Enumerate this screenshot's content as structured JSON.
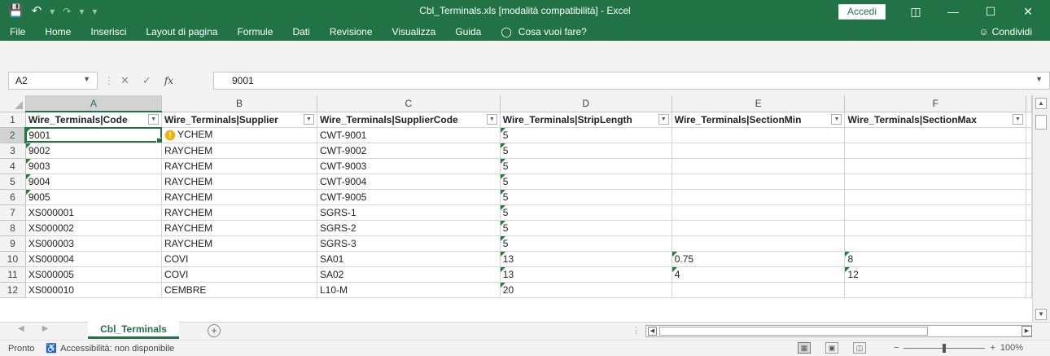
{
  "window": {
    "title": "Cbl_Terminals.xls  [modalità compatibilità]  -  Excel",
    "signin_label": "Accedi",
    "qat": {
      "save_icon": "save-icon",
      "undo_icon": "undo-icon",
      "redo_icon": "redo-icon"
    }
  },
  "ribbon": {
    "tabs": [
      "File",
      "Home",
      "Inserisci",
      "Layout di pagina",
      "Formule",
      "Dati",
      "Revisione",
      "Visualizza",
      "Guida"
    ],
    "tellme_label": "Cosa vuoi fare?",
    "share_label": "Condividi"
  },
  "formula_bar": {
    "name_box": "A2",
    "fx_label": "fx",
    "value": "9001"
  },
  "grid": {
    "columns": [
      "A",
      "B",
      "C",
      "D",
      "E",
      "F"
    ],
    "selected_column": "A",
    "selected_row": 2,
    "header_row": [
      "Wire_Terminals|Code",
      "Wire_Terminals|Supplier",
      "Wire_Terminals|SupplierCode",
      "Wire_Terminals|StripLength",
      "Wire_Terminals|SectionMin",
      "Wire_Terminals|SectionMax"
    ],
    "rows": [
      {
        "n": "2",
        "cells": [
          "9001",
          "YCHEM",
          "CWT-9001",
          "5",
          "",
          ""
        ]
      },
      {
        "n": "3",
        "cells": [
          "9002",
          "RAYCHEM",
          "CWT-9002",
          "5",
          "",
          ""
        ]
      },
      {
        "n": "4",
        "cells": [
          "9003",
          "RAYCHEM",
          "CWT-9003",
          "5",
          "",
          ""
        ]
      },
      {
        "n": "5",
        "cells": [
          "9004",
          "RAYCHEM",
          "CWT-9004",
          "5",
          "",
          ""
        ]
      },
      {
        "n": "6",
        "cells": [
          "9005",
          "RAYCHEM",
          "CWT-9005",
          "5",
          "",
          ""
        ]
      },
      {
        "n": "7",
        "cells": [
          "XS000001",
          "RAYCHEM",
          "SGRS-1",
          "5",
          "",
          ""
        ]
      },
      {
        "n": "8",
        "cells": [
          "XS000002",
          "RAYCHEM",
          "SGRS-2",
          "5",
          "",
          ""
        ]
      },
      {
        "n": "9",
        "cells": [
          "XS000003",
          "RAYCHEM",
          "SGRS-3",
          "5",
          "",
          ""
        ]
      },
      {
        "n": "10",
        "cells": [
          "XS000004",
          "COVI",
          "SA01",
          "13",
          "0.75",
          "8"
        ]
      },
      {
        "n": "11",
        "cells": [
          "XS000005",
          "COVI",
          "SA02",
          "13",
          "4",
          "12"
        ]
      },
      {
        "n": "12",
        "cells": [
          "XS000010",
          "CEMBRE",
          "L10-M",
          "20",
          "",
          ""
        ]
      }
    ],
    "error_icon": "warning-icon"
  },
  "sheets": {
    "active": "Cbl_Terminals"
  },
  "status": {
    "ready": "Pronto",
    "accessibility": "Accessibilità: non disponibile",
    "zoom": "100%"
  }
}
